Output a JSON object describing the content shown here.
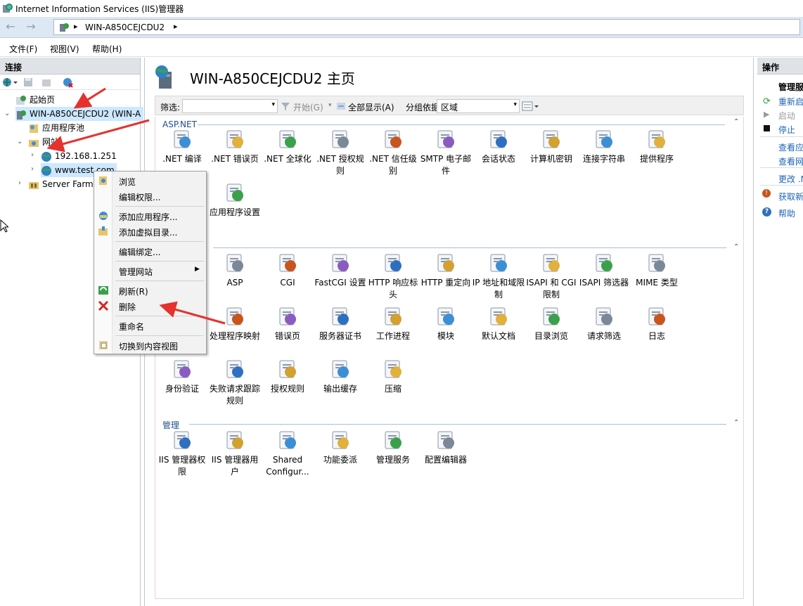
{
  "window": {
    "title": "Internet Information Services (IIS)管理器"
  },
  "nav": {
    "breadcrumb": "WIN-A850CEJCDU2",
    "arrow": "▸"
  },
  "menu": [
    "文件(F)",
    "视图(V)",
    "帮助(H)"
  ],
  "connections": {
    "title": "连接",
    "tree": {
      "start": "起始页",
      "server": "WIN-A850CEJCDU2 (WIN-A",
      "app_pools": "应用程序池",
      "sites": "网站",
      "site1": "192.168.1.251",
      "site2": "www.test.com",
      "farms": "Server Farms"
    }
  },
  "main": {
    "title": "WIN-A850CEJCDU2 主页",
    "filter": {
      "label": "筛选:",
      "go": "开始(G)",
      "show_all": "全部显示(A)",
      "group_label": "分组依据:",
      "group_value": "区域"
    },
    "sections": [
      {
        "name": "ASP.NET",
        "items": [
          ".NET 编译",
          ".NET 错误页",
          ".NET 全球化",
          ".NET 授权规则",
          ".NET 信任级别",
          "SMTP 电子邮件",
          "会话状态",
          "计算机密钥",
          "连接字符串",
          "提供程序",
          "应用程序设置"
        ]
      },
      {
        "name": "",
        "items": [
          "ASP",
          "CGI",
          "FastCGI 设置",
          "HTTP 响应标头",
          "HTTP 重定向",
          "IP 地址和域限制",
          "ISAPI 和 CGI 限制",
          "ISAPI 筛选器",
          "MIME 类型",
          "处理程序映射",
          "错误页",
          "服务器证书",
          "工作进程",
          "模块",
          "默认文档",
          "目录浏览",
          "请求筛选",
          "日志",
          "身份验证",
          "失败请求跟踪规则",
          "授权规则",
          "输出缓存",
          "压缩"
        ]
      },
      {
        "name": "管理",
        "items": [
          "IIS 管理器权限",
          "IIS 管理器用户",
          "Shared Configur...",
          "功能委派",
          "管理服务",
          "配置编辑器"
        ]
      }
    ]
  },
  "actions": {
    "title": "操作",
    "items": [
      "管理服",
      "重新启",
      "启动",
      "停止",
      "查看应",
      "查看网",
      "更改 .N",
      "获取新",
      "帮助"
    ]
  },
  "context_menu": [
    "浏览",
    "编辑权限...",
    "添加应用程序...",
    "添加虚拟目录...",
    "编辑绑定...",
    "管理网站",
    "刷新(R)",
    "删除",
    "重命名",
    "切换到内容视图"
  ],
  "colors": {
    "accent": "#1d64b8",
    "header_bg": "#dfe3e8",
    "annotation": "#e5322d"
  }
}
